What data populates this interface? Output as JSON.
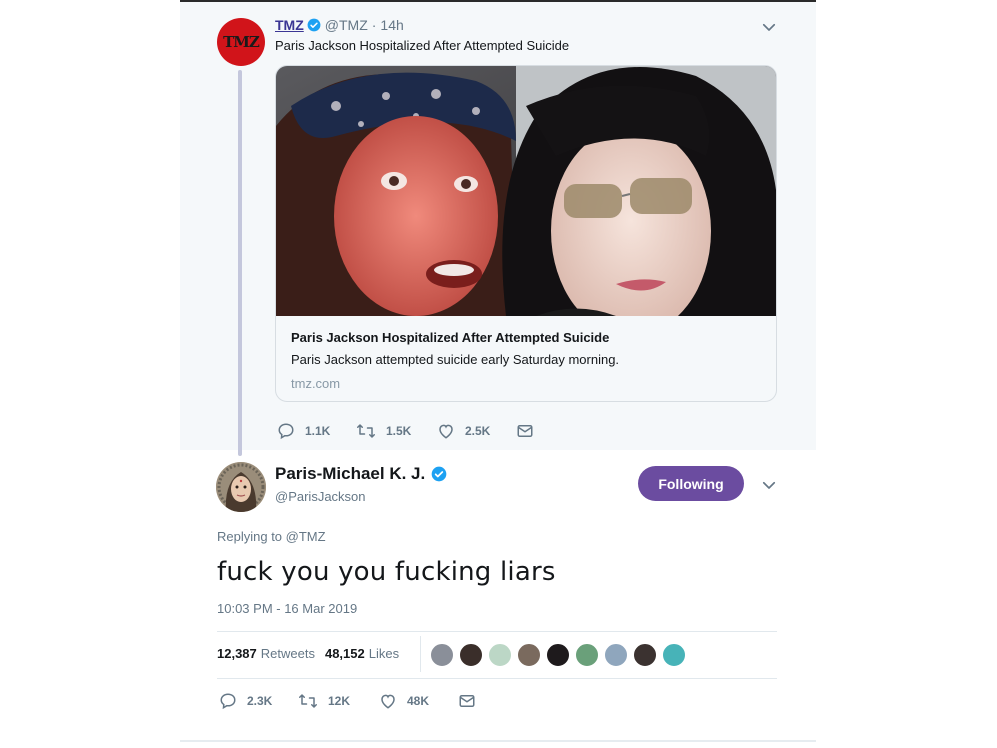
{
  "parent_tweet": {
    "avatar_text": "TMZ",
    "name": "TMZ",
    "handle": "@TMZ",
    "separator": "·",
    "time": "14h",
    "text": "Paris Jackson Hospitalized After Attempted Suicide",
    "card": {
      "title": "Paris Jackson Hospitalized After Attempted Suicide",
      "description": "Paris Jackson attempted suicide early Saturday morning.",
      "domain": "tmz.com"
    },
    "actions": {
      "replies": "1.1K",
      "retweets": "1.5K",
      "likes": "2.5K"
    }
  },
  "main_tweet": {
    "name": "Paris-Michael K. J.",
    "handle": "@ParisJackson",
    "follow_label": "Following",
    "replying_prefix": "Replying to",
    "replying_to": "@TMZ",
    "text": "fuck you you fucking liars",
    "timestamp": "10:03 PM - 16 Mar 2019",
    "retweet_count": "12,387",
    "retweet_label": "Retweets",
    "like_count": "48,152",
    "like_label": "Likes",
    "liker_faces": [
      "#8a8f99",
      "#3a2e2a",
      "#bcd7c6",
      "#7a6a5e",
      "#1e1a1c",
      "#6aa07a",
      "#8fa6bd",
      "#3b3230",
      "#47b3b8"
    ],
    "actions": {
      "replies": "2.3K",
      "retweets": "12K",
      "likes": "48K"
    }
  },
  "colors": {
    "follow_button": "#6b4ca0",
    "tmz_red": "#d1141a",
    "verified_blue": "#1da1f2",
    "muted_text": "#657786"
  }
}
